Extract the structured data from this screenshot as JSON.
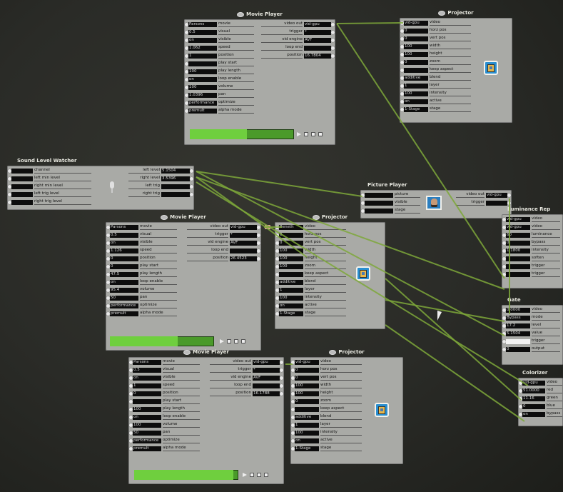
{
  "colors": {
    "canvas": "#2b2c28",
    "actor": "#a9aaa6",
    "wire": "#7ea83a",
    "scrub": "#4a9a2a",
    "scrub_fill": "#6fcf3e"
  },
  "icons": {
    "play": "play-icon",
    "stop": "stop-icon",
    "pause": "pause-icon",
    "loop": "loop-icon",
    "preview": "projector-preview-icon",
    "mic": "microphone-icon",
    "picture": "portrait-icon",
    "cursor": "mouse-cursor-icon"
  },
  "movie1": {
    "title": "Movie Player",
    "inputs": [
      {
        "value": "Parsons",
        "label": "movie"
      },
      {
        "value": "0.5",
        "label": "visual"
      },
      {
        "value": "on",
        "label": "visible"
      },
      {
        "value": "1.062",
        "label": "speed"
      },
      {
        "value": "1",
        "label": "position"
      },
      {
        "value": "",
        "label": "play start"
      },
      {
        "value": "100",
        "label": "play length"
      },
      {
        "value": "on",
        "label": "loop enable"
      },
      {
        "value": "100",
        "label": "volume"
      },
      {
        "value": "1.0396",
        "label": "pan"
      },
      {
        "value": "performance",
        "label": "optimize"
      },
      {
        "value": "premult",
        "label": "alpha mode"
      }
    ],
    "outputs": [
      {
        "label": "video out",
        "value": "vid-gpu"
      },
      {
        "label": "trigger",
        "value": "*"
      },
      {
        "label": "vid engine",
        "value": "AVF"
      },
      {
        "label": "loop end",
        "value": ""
      },
      {
        "label": "position",
        "value": "16.7804"
      }
    ],
    "progress": 0.55
  },
  "projector1": {
    "title": "Projector",
    "inputs": [
      {
        "value": "vid-gpu",
        "label": "video"
      },
      {
        "value": "0",
        "label": "horz pos"
      },
      {
        "value": "0",
        "label": "vert pos"
      },
      {
        "value": "100",
        "label": "width"
      },
      {
        "value": "100",
        "label": "height"
      },
      {
        "value": "0",
        "label": "zoom"
      },
      {
        "value": "",
        "label": "keep aspect"
      },
      {
        "value": "additive",
        "label": "blend"
      },
      {
        "value": "1",
        "label": "layer"
      },
      {
        "value": "100",
        "label": "intensity"
      },
      {
        "value": "on",
        "label": "active"
      },
      {
        "value": "1-Stage",
        "label": "stage"
      }
    ]
  },
  "sound": {
    "title": "Sound Level Watcher",
    "inputs": [
      {
        "value": "",
        "label": "channel"
      },
      {
        "value": "",
        "label": "left min level"
      },
      {
        "value": "",
        "label": "right min level"
      },
      {
        "value": "",
        "label": "left trig level"
      },
      {
        "value": "",
        "label": "right trig level"
      }
    ],
    "outputs": [
      {
        "label": "left level",
        "value": "5.1504"
      },
      {
        "label": "right level",
        "value": "3.5396"
      },
      {
        "label": "left trig",
        "value": ""
      },
      {
        "label": "right trig",
        "value": ""
      }
    ]
  },
  "picture": {
    "title": "Picture Player",
    "inputs": [
      {
        "value": "",
        "label": "picture"
      },
      {
        "value": "",
        "label": "visible"
      },
      {
        "value": "",
        "label": "stage"
      }
    ],
    "outputs": [
      {
        "label": "video out",
        "value": "vid-gpu"
      },
      {
        "label": "trigger",
        "value": ""
      }
    ]
  },
  "movie2": {
    "title": "Movie Player",
    "inputs": [
      {
        "value": "Parsons",
        "label": "movie"
      },
      {
        "value": "0.5",
        "label": "visual"
      },
      {
        "value": "on",
        "label": "visible"
      },
      {
        "value": "1.126",
        "label": "speed"
      },
      {
        "value": "0",
        "label": "position"
      },
      {
        "value": "0",
        "label": "play start"
      },
      {
        "value": "47.5",
        "label": "play length"
      },
      {
        "value": "on",
        "label": "loop enable"
      },
      {
        "value": "95.4",
        "label": "volume"
      },
      {
        "value": "50",
        "label": "pan"
      },
      {
        "value": "performance",
        "label": "optimize"
      },
      {
        "value": "premult",
        "label": "alpha mode"
      }
    ],
    "outputs": [
      {
        "label": "video out",
        "value": "vid-gpu"
      },
      {
        "label": "trigger",
        "value": "*"
      },
      {
        "label": "vid engine",
        "value": "AVF"
      },
      {
        "label": "loop end",
        "value": ""
      },
      {
        "label": "position",
        "value": "26.4523"
      }
    ],
    "progress": 0.65
  },
  "projector2": {
    "title": "Projector",
    "inputs": [
      {
        "value": "Beneth",
        "label": "video"
      },
      {
        "value": "0",
        "label": "horz pos"
      },
      {
        "value": "0",
        "label": "vert pos"
      },
      {
        "value": "100",
        "label": "width"
      },
      {
        "value": "100",
        "label": "height"
      },
      {
        "value": "100",
        "label": "zoom"
      },
      {
        "value": "",
        "label": "keep aspect"
      },
      {
        "value": "additive",
        "label": "blend"
      },
      {
        "value": "1",
        "label": "layer"
      },
      {
        "value": "100",
        "label": "intensity"
      },
      {
        "value": "on",
        "label": "active"
      },
      {
        "value": "1-Stage",
        "label": "stage"
      }
    ]
  },
  "movie3": {
    "title": "Movie Player",
    "inputs": [
      {
        "value": "Parsons",
        "label": "movie"
      },
      {
        "value": "0.5",
        "label": "visual"
      },
      {
        "value": "on",
        "label": "visible"
      },
      {
        "value": "1",
        "label": "speed"
      },
      {
        "value": "0",
        "label": "position"
      },
      {
        "value": "",
        "label": "play start"
      },
      {
        "value": "100",
        "label": "play length"
      },
      {
        "value": "on",
        "label": "loop enable"
      },
      {
        "value": "100",
        "label": "volume"
      },
      {
        "value": "50",
        "label": "pan"
      },
      {
        "value": "performance",
        "label": "optimize"
      },
      {
        "value": "premult",
        "label": "alpha mode"
      }
    ],
    "outputs": [
      {
        "label": "video out",
        "value": "vid-gpu"
      },
      {
        "label": "trigger",
        "value": "*"
      },
      {
        "label": "vid engine",
        "value": "AVF"
      },
      {
        "label": "loop end",
        "value": ""
      },
      {
        "label": "position",
        "value": "16.1788"
      }
    ],
    "progress": 0.95
  },
  "projector3": {
    "title": "Projector",
    "inputs": [
      {
        "value": "vid-gpu",
        "label": "video"
      },
      {
        "value": "0",
        "label": "horz pos"
      },
      {
        "value": "0",
        "label": "vert pos"
      },
      {
        "value": "100",
        "label": "width"
      },
      {
        "value": "100",
        "label": "height"
      },
      {
        "value": "0",
        "label": "zoom"
      },
      {
        "value": "",
        "label": "keep aspect"
      },
      {
        "value": "additive",
        "label": "blend"
      },
      {
        "value": "1",
        "label": "layer"
      },
      {
        "value": "100",
        "label": "intensity"
      },
      {
        "value": "on",
        "label": "active"
      },
      {
        "value": "1-Stage",
        "label": "stage"
      }
    ]
  },
  "luminance": {
    "title": "Luminance Rep",
    "inputs": [
      {
        "value": "vid-gpu",
        "label": "video"
      },
      {
        "value": "vid-gpu",
        "label": "video"
      },
      {
        "value": "60",
        "label": "luminance"
      },
      {
        "value": "0",
        "label": "bypass"
      },
      {
        "value": "1.1800",
        "label": "intensity"
      },
      {
        "value": "",
        "label": "soften"
      },
      {
        "value": "",
        "label": "trigger"
      },
      {
        "value": "",
        "label": "trigger"
      }
    ]
  },
  "gate": {
    "title": "Gate",
    "inputs": [
      {
        "value": "0.0000",
        "label": "video"
      },
      {
        "value": "Bypass",
        "label": "mode"
      },
      {
        "value": "17.2",
        "label": "level"
      },
      {
        "value": "5.1504",
        "label": "value"
      },
      {
        "value": "",
        "label": "trigger"
      },
      {
        "value": "0",
        "label": "output"
      }
    ]
  },
  "colorizer": {
    "title": "Colorizer",
    "inputs": [
      {
        "value": "vid-gpu",
        "label": "video"
      },
      {
        "value": "51.0000",
        "label": "red"
      },
      {
        "value": "11.16",
        "label": "green"
      },
      {
        "value": "0",
        "label": "blue"
      },
      {
        "value": "on",
        "label": "bypass"
      }
    ]
  }
}
